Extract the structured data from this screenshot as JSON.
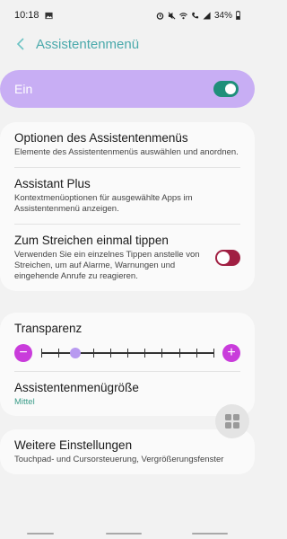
{
  "status_bar": {
    "time": "10:18",
    "battery": "34%",
    "icons": [
      "image-icon",
      "alarm-icon",
      "mute-icon",
      "wifi-icon",
      "call-icon",
      "signal-icon",
      "battery-icon"
    ]
  },
  "header": {
    "title": "Assistentenmenü",
    "back_icon": "chevron-left-icon"
  },
  "master_switch": {
    "label": "Ein",
    "state": "on"
  },
  "card1": {
    "items": [
      {
        "title": "Optionen des Assistentenmenüs",
        "subtitle": "Elemente des Assistentenmenüs auswählen und anordnen."
      },
      {
        "title": "Assistant Plus",
        "subtitle": "Kontextmenüoptionen für ausgewählte Apps im Assistentenmenü anzeigen."
      },
      {
        "title": "Zum Streichen einmal tippen",
        "subtitle": "Verwenden Sie ein einzelnes Tippen anstelle von Streichen, um auf Alarme, Warnungen und eingehende Anrufe zu reagieren.",
        "toggle": "off"
      }
    ]
  },
  "card2": {
    "transparency": {
      "title": "Transparenz",
      "minus": "−",
      "plus": "+",
      "steps": 10,
      "level_step": 2
    },
    "size": {
      "title": "Assistentenmenügröße",
      "value": "Mittel"
    }
  },
  "card3": {
    "title": "Weitere Einstellungen",
    "subtitle": "Touchpad- und Cursorsteuerung, Vergrößerungsfenster"
  },
  "colors": {
    "accent": "#4aa9ab",
    "master_bg": "#c8aef4",
    "toggle_on": "#1f8f7a",
    "toggle_off": "#a01f42",
    "slider_buttons": "#c93cdb"
  }
}
